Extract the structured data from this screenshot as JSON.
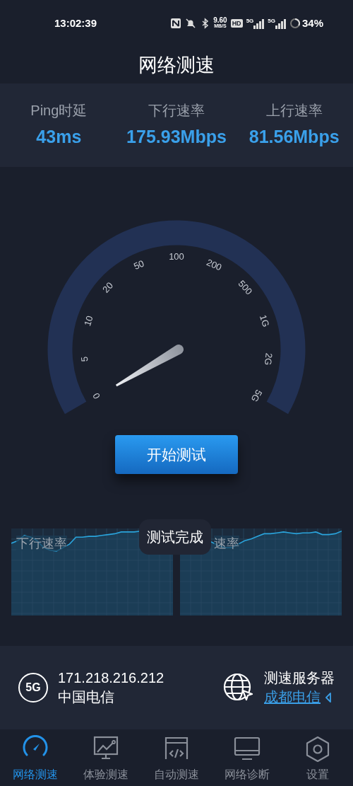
{
  "status_bar": {
    "time": "13:02:39",
    "net_speed": "9.60",
    "net_unit": "MB/S",
    "hd": "HD",
    "sim1": "5G",
    "sim2": "5G",
    "battery": "34%"
  },
  "title": "网络测速",
  "stats": [
    {
      "label": "Ping时延",
      "value": "43ms"
    },
    {
      "label": "下行速率",
      "value": "175.93Mbps"
    },
    {
      "label": "上行速率",
      "value": "81.56Mbps"
    }
  ],
  "gauge": {
    "ticks": [
      "0",
      "5",
      "10",
      "20",
      "50",
      "100",
      "200",
      "500",
      "1G",
      "2G",
      "5G"
    ]
  },
  "start_button": "开始测试",
  "charts": [
    {
      "label": "下行速率"
    },
    {
      "label": "速率"
    }
  ],
  "toast": "测试完成",
  "network": {
    "badge": "5G",
    "ip": "171.218.216.212",
    "carrier": "中国电信"
  },
  "server": {
    "label": "测速服务器",
    "name": "成都电信"
  },
  "tabs": [
    {
      "label": "网络测速",
      "selected": true
    },
    {
      "label": "体验测速",
      "selected": false
    },
    {
      "label": "自动测速",
      "selected": false
    },
    {
      "label": "网络诊断",
      "selected": false
    },
    {
      "label": "设置",
      "selected": false
    }
  ]
}
